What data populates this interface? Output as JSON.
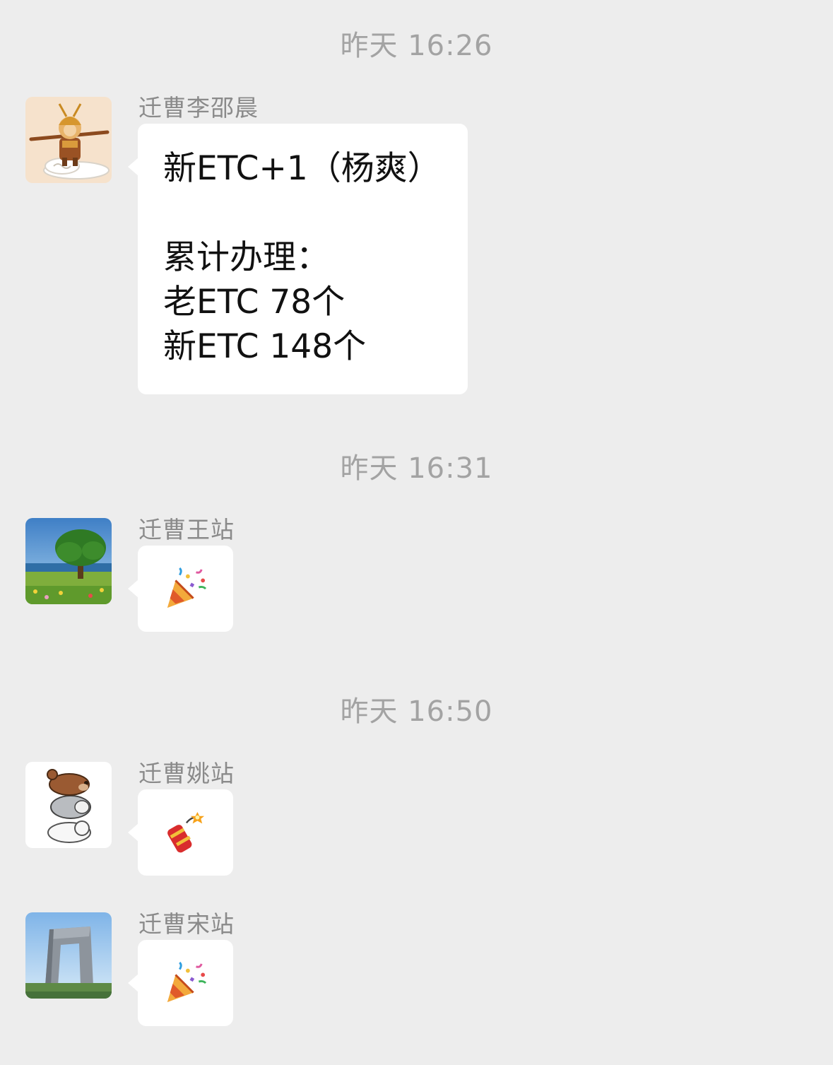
{
  "timestamps": [
    "昨天 16:26",
    "昨天 16:31",
    "昨天 16:50"
  ],
  "messages": [
    {
      "sender": "迁曹李邵晨",
      "avatar_icon": "monkey-king-avatar-icon",
      "lines": [
        "新ETC+1（杨爽）",
        "",
        "累计办理：",
        "老ETC 78个",
        "新ETC 148个"
      ]
    },
    {
      "sender": "迁曹王站",
      "avatar_icon": "tree-landscape-avatar-icon",
      "emoji": "party-popper-icon"
    },
    {
      "sender": "迁曹姚站",
      "avatar_icon": "stacked-bears-avatar-icon",
      "emoji": "firecracker-icon"
    },
    {
      "sender": "迁曹宋站",
      "avatar_icon": "cctv-tower-avatar-icon",
      "emoji": "party-popper-icon"
    }
  ]
}
